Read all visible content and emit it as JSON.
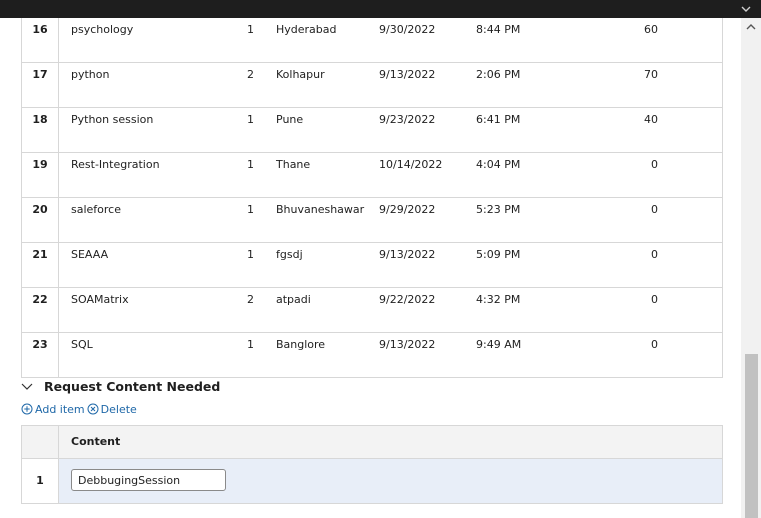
{
  "sessions": [
    {
      "no": "16",
      "name": "psychology",
      "count": "1",
      "city": "Hyderabad",
      "date": "9/30/2022",
      "time": "8:44 PM",
      "value": "60"
    },
    {
      "no": "17",
      "name": "python",
      "count": "2",
      "city": "Kolhapur",
      "date": "9/13/2022",
      "time": "2:06 PM",
      "value": "70"
    },
    {
      "no": "18",
      "name": "Python session",
      "count": "1",
      "city": "Pune",
      "date": "9/23/2022",
      "time": "6:41 PM",
      "value": "40"
    },
    {
      "no": "19",
      "name": "Rest-Integration",
      "count": "1",
      "city": "Thane",
      "date": "10/14/2022",
      "time": "4:04 PM",
      "value": "0"
    },
    {
      "no": "20",
      "name": "saleforce",
      "count": "1",
      "city": "Bhuvaneshawar",
      "date": "9/29/2022",
      "time": "5:23 PM",
      "value": "0"
    },
    {
      "no": "21",
      "name": "SEAAA",
      "count": "1",
      "city": "fgsdj",
      "date": "9/13/2022",
      "time": "5:09 PM",
      "value": "0"
    },
    {
      "no": "22",
      "name": "SOAMatrix",
      "count": "2",
      "city": "atpadi",
      "date": "9/22/2022",
      "time": "4:32 PM",
      "value": "0"
    },
    {
      "no": "23",
      "name": "SQL",
      "count": "1",
      "city": "Banglore",
      "date": "9/13/2022",
      "time": "9:49 AM",
      "value": "0"
    }
  ],
  "section": {
    "title": "Request Content Needed"
  },
  "actions": {
    "add": "Add item",
    "delete": "Delete"
  },
  "content_table": {
    "header": "Content",
    "rows": [
      {
        "no": "1",
        "value": "DebbugingSession"
      }
    ]
  },
  "colors": {
    "link": "#1f68a8",
    "row_highlight": "#e8eef8",
    "border": "#d7d7d7"
  },
  "icons": {
    "top_right": "chevron-down-icon",
    "section": "chevron-down-icon",
    "add": "plus-circle-icon",
    "delete": "x-circle-icon",
    "scroll_up": "chevron-up-icon"
  }
}
